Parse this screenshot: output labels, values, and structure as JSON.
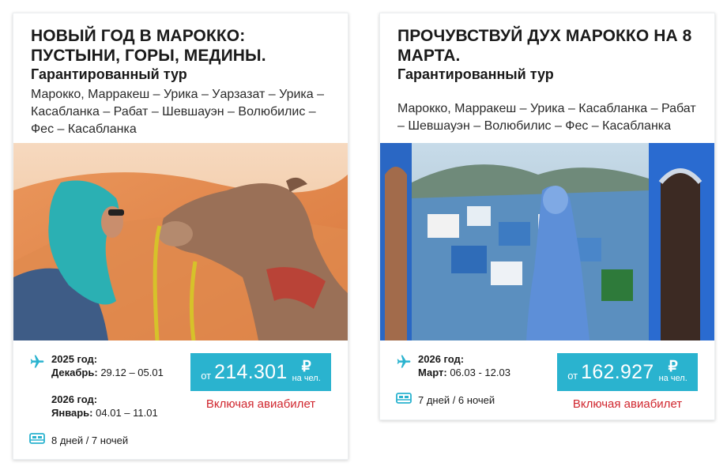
{
  "cards": [
    {
      "title": "НОВЫЙ ГОД В МАРОККО: ПУСТЫНИ, ГОРЫ, МЕДИНЫ.",
      "subtitle": "Гарантированный тур",
      "route": "Марокко, Марракеш – Урика – Уарзазат – Урика – Касабланка – Рабат – Шевшауэн – Волюбилис – Фес – Касабланка",
      "dates": [
        {
          "year": "2025 год:",
          "month": "Декабрь:",
          "range": "29.12 – 05.01"
        },
        {
          "year": "2026 год:",
          "month": "Январь:",
          "range": "04.01 – 11.01"
        }
      ],
      "duration": "8 дней / 7 ночей",
      "price": {
        "from": "от",
        "amount": "214.301",
        "currency": "₽",
        "per": "на чел."
      },
      "flight_note": "Включая авиабилет",
      "image_icon": "camel-desert-photo"
    },
    {
      "title": "ПРОЧУВСТВУЙ ДУХ МАРОККО НА 8 МАРТА.",
      "subtitle": "Гарантированный тур",
      "route": "Марокко, Марракеш – Урика – Касабланка – Рабат – Шевшауэн – Волюбилис – Фес – Касабланка",
      "dates": [
        {
          "year": "2026 год:",
          "month": "Март:",
          "range": "06.03 - 12.03"
        }
      ],
      "duration": "7 дней / 6 ночей",
      "price": {
        "from": "от",
        "amount": "162.927",
        "currency": "₽",
        "per": "на чел."
      },
      "flight_note": "Включая авиабилет",
      "image_icon": "chefchaouen-blue-city-photo"
    }
  ],
  "colors": {
    "accent": "#2ab3cf",
    "flight_note": "#d0262e",
    "icon": "#2ab3cf"
  }
}
